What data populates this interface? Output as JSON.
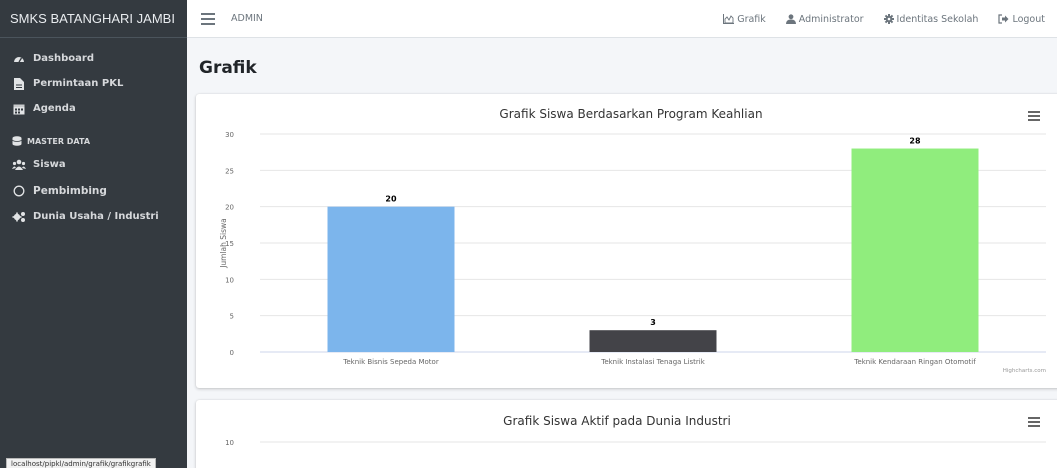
{
  "brand": "SMKS BATANGHARI JAMBI",
  "sidebar": {
    "items": [
      {
        "label": "Dashboard",
        "icon": "tachometer-icon"
      },
      {
        "label": "Permintaan PKL",
        "icon": "file-icon"
      },
      {
        "label": "Agenda",
        "icon": "calendar-icon"
      }
    ],
    "section_header": "MASTER DATA",
    "master_items": [
      {
        "label": "Siswa",
        "icon": "users-icon"
      },
      {
        "label": "Pembimbing",
        "icon": "circle-icon"
      },
      {
        "label": "Dunia Usaha / Industri",
        "icon": "cogs-icon"
      }
    ]
  },
  "topbar": {
    "left_label": "ADMIN",
    "links": [
      {
        "label": "Grafik",
        "icon": "chart-area-icon"
      },
      {
        "label": "Administrator",
        "icon": "user-icon"
      },
      {
        "label": "Identitas Sekolah",
        "icon": "cog-icon"
      },
      {
        "label": "Logout",
        "icon": "sign-out-icon"
      }
    ]
  },
  "page_title": "Grafik",
  "chart_data": [
    {
      "type": "bar",
      "title": "Grafik Siswa Berdasarkan Program Keahlian",
      "ylabel": "Jumlah Siswa",
      "xlabel": "",
      "categories": [
        "Teknik Bisnis Sepeda Motor",
        "Teknik Instalasi Tenaga Listrik",
        "Teknik Kendaraan Ringan Otomotif"
      ],
      "values": [
        20,
        3,
        28
      ],
      "colors": [
        "#7cb5ec",
        "#434348",
        "#90ed7d"
      ],
      "ylim": [
        0,
        30
      ],
      "yticks": [
        0,
        5,
        10,
        15,
        20,
        25,
        30
      ],
      "grid": true,
      "credits": "Highcharts.com"
    },
    {
      "type": "bar",
      "title": "Grafik Siswa Aktif pada Dunia Industri",
      "yticks": [
        10
      ]
    }
  ],
  "status_url": "localhost/pipkl/admin/grafik/grafikgrafik"
}
